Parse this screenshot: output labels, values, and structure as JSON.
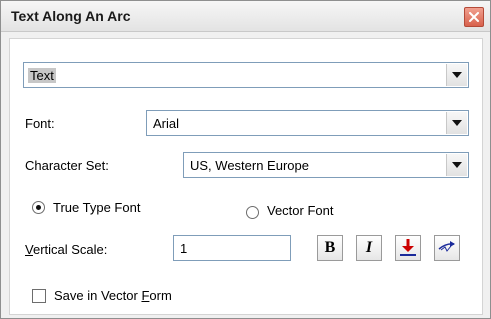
{
  "window": {
    "title": "Text Along An Arc",
    "close_icon": "close-icon"
  },
  "text_combo": {
    "value": "Text"
  },
  "font": {
    "label": "Font:",
    "value": "Arial"
  },
  "charset": {
    "label": "Character Set:",
    "value": "US, Western Europe"
  },
  "font_type": {
    "true_type_label": "True Type Font",
    "vector_label": "Vector Font",
    "selected": "True Type Font"
  },
  "vertical_scale": {
    "label_mnemonic": "V",
    "label_rest": "ertical Scale:",
    "value": "1"
  },
  "toolbar": {
    "bold_label": "B",
    "italic_label": "I",
    "icons": [
      "bold-icon",
      "italic-icon",
      "align-bottom-icon",
      "text-arc-icon"
    ]
  },
  "save_vector": {
    "label_prefix": "Save in Vector ",
    "label_mnemonic": "F",
    "label_rest": "orm",
    "checked": false
  },
  "colors": {
    "accent_red": "#cc0000",
    "close_red": "#d8614c",
    "field_border": "#7f9db9"
  }
}
